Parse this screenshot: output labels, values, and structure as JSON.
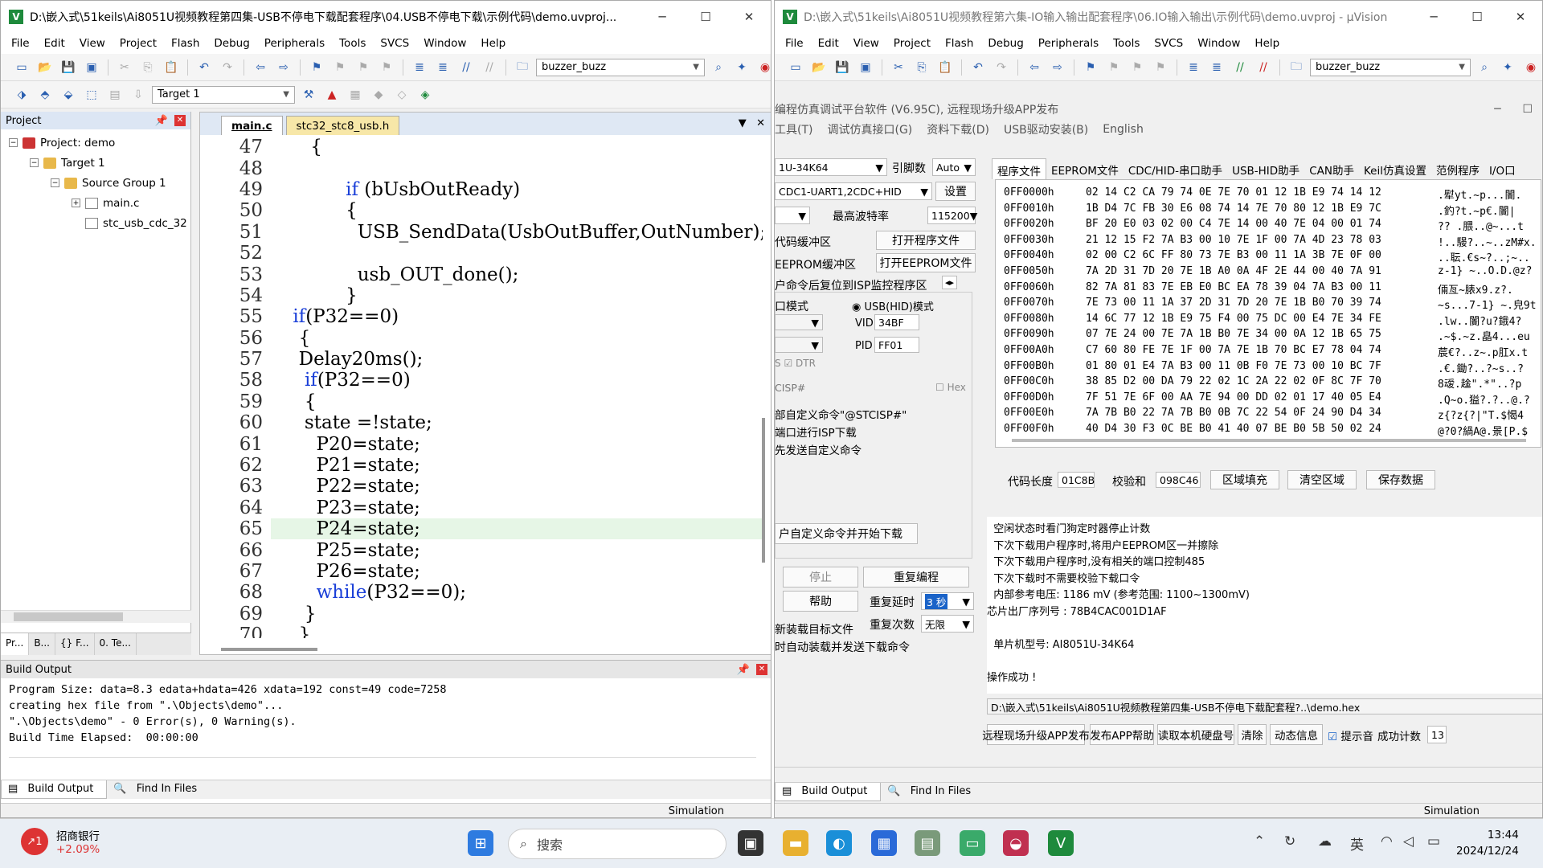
{
  "left": {
    "title": "D:\\嵌入式\\51keils\\Ai8051U视频教程第四集-USB不停电下载配套程序\\04.USB不停电下载\\示例代码\\demo.uvproj...",
    "menu": [
      "File",
      "Edit",
      "View",
      "Project",
      "Flash",
      "Debug",
      "Peripherals",
      "Tools",
      "SVCS",
      "Window",
      "Help"
    ],
    "toolbar_combo": "buzzer_buzz",
    "target_combo": "Target 1",
    "project_title": "Project",
    "tree": [
      "Project: demo",
      "Target 1",
      "Source Group 1",
      "main.c",
      "stc_usb_cdc_32"
    ],
    "ptabs": [
      "Pr...",
      "B...",
      "{} F...",
      "0. Te..."
    ],
    "tabs": [
      "main.c",
      "stc32_stc8_usb.h"
    ],
    "code": [
      {
        "n": "47",
        "t": "    {"
      },
      {
        "n": "48",
        "t": ""
      },
      {
        "n": "49",
        "k": "if",
        "t": " (bUsbOutReady)",
        "i": "          "
      },
      {
        "n": "50",
        "t": "          {"
      },
      {
        "n": "51",
        "t": "            USB_SendData(UsbOutBuffer,OutNumber);"
      },
      {
        "n": "52",
        "t": ""
      },
      {
        "n": "53",
        "t": "            usb_OUT_done();"
      },
      {
        "n": "54",
        "t": "          }"
      },
      {
        "n": "55",
        "k": "if",
        "t": "(P32==0)",
        "i": " "
      },
      {
        "n": "56",
        "t": "  {"
      },
      {
        "n": "57",
        "t": "  Delay20ms();"
      },
      {
        "n": "58",
        "k": "if",
        "t": "(P32==0)",
        "i": "   "
      },
      {
        "n": "59",
        "t": "   {"
      },
      {
        "n": "60",
        "t": "   state =!state;"
      },
      {
        "n": "61",
        "t": "     P20=state;"
      },
      {
        "n": "62",
        "t": "     P21=state;"
      },
      {
        "n": "63",
        "t": "     P22=state;"
      },
      {
        "n": "64",
        "t": "     P23=state;"
      },
      {
        "n": "65",
        "t": "     P24=state;",
        "hl": true
      },
      {
        "n": "66",
        "t": "     P25=state;"
      },
      {
        "n": "67",
        "t": "     P26=state;"
      },
      {
        "n": "68",
        "k": "while",
        "t": "(P32==0);",
        "i": "     "
      },
      {
        "n": "69",
        "t": "   }"
      },
      {
        "n": "70",
        "t": "  }"
      }
    ],
    "build_title": "Build Output",
    "build_lines": [
      "Program Size: data=8.3 edata+hdata=426 xdata=192 const=49 code=7258",
      "creating hex file from \".\\Objects\\demo\"...",
      "\".\\Objects\\demo\" - 0 Error(s), 0 Warning(s).",
      "Build Time Elapsed:  00:00:00"
    ],
    "btabs": [
      "Build Output",
      "Find In Files"
    ],
    "status": "Simulation"
  },
  "right": {
    "title": "D:\\嵌入式\\51keils\\Ai8051U视频教程第六集-IO输入输出配套程序\\06.IO输入输出\\示例代码\\demo.uvproj - µVision",
    "menu": [
      "File",
      "Edit",
      "View",
      "Project",
      "Flash",
      "Debug",
      "Peripherals",
      "Tools",
      "SVCS",
      "Window",
      "Help"
    ],
    "toolbar_combo": "buzzer_buzz",
    "tool_title": "编程仿真调试平台软件 (V6.95C), 远程现场升级APP发布",
    "tool_menu": [
      "工具(T)",
      "调试仿真接口(G)",
      "资料下载(D)",
      "USB驱动安装(B)",
      "English"
    ],
    "mcu": "1U-34K64",
    "pin_label": "引脚数",
    "pin_val": "Auto",
    "port": "CDC1-UART1,2CDC+HID",
    "settings": "设置",
    "baud_label": "最高波特率",
    "baud": "115200",
    "code_buf": "代码缓冲区",
    "open_prog": "打开程序文件",
    "eeprom_buf": "EEPROM缓冲区",
    "open_eeprom": "打开EEPROM文件",
    "after_cmd": "户命令后复位到ISP监控程序区",
    "mode_label": "口模式",
    "usb_mode": "USB(HID)模式",
    "vid_label": "VID",
    "vid": "34BF",
    "pid_label": "PID",
    "pid": "FF01",
    "s_label": "S",
    "dtr": "DTR",
    "isp_val": "CISP#",
    "hex_chk": "Hex",
    "opt1": "部自定义命令\"@STCISP#\"",
    "opt2": "端口进行ISP下载",
    "opt3": "先发送自定义命令",
    "custom_dl": "户自定义命令并开始下载",
    "stop": "停止",
    "reprog": "重复编程",
    "help": "帮助",
    "delay_label": "重复延时",
    "delay": "3 秒",
    "count_label": "重复次数",
    "count": "无限",
    "reload": "新装载目标文件",
    "autoload": "时自动装载并发送下载命令",
    "ptabs": [
      "程序文件",
      "EEPROM文件",
      "CDC/HID-串口助手",
      "USB-HID助手",
      "CAN助手",
      "Keil仿真设置",
      "范例程序",
      "I/O口"
    ],
    "hex": [
      {
        "a": "0FF0000h",
        "b": "02 14 C2 CA 79 74 0E 7E 70 01 12 1B E9 74 14 12",
        "c": ".犚yt.~p...闠."
      },
      {
        "a": "0FF0010h",
        "b": "1B D4 7C FB 30 E6 08 74 14 7E 70 80 12 1B E9 7C",
        "c": ".釣?t.~p€.闠|"
      },
      {
        "a": "0FF0020h",
        "b": "BF 20 E0 03 02 00 C4 7E 14 00 40 7E 04 00 01 74",
        "c": "?? .腲..@~...t"
      },
      {
        "a": "0FF0030h",
        "b": "21 12 15 F2 7A B3 00 10 7E 1F 00 7A 4D 23 78 03",
        "c": "!..騴?..~..zM#x."
      },
      {
        "a": "0FF0040h",
        "b": "02 00 C2 6C FF 80 73 7E B3 00 11 1A 3B 7E 0F 00",
        "c": "..耺.€s~?..;~.."
      },
      {
        "a": "0FF0050h",
        "b": "7A 2D 31 7D 20 7E 1B A0 0A 4F 2E 44 00 40 7A 91",
        "c": "z-1} ~..O.D.@z?"
      },
      {
        "a": "0FF0060h",
        "b": "82 7A 81 83 7E EB E0 BC EA 78 39 04 7A B3 00 11",
        "c": "倆亙~脿x9.z?."
      },
      {
        "a": "0FF0070h",
        "b": "7E 73 00 11 1A 37 2D 31 7D 20 7E 1B B0 70 39 74",
        "c": "~s...7-1} ~.皃9t"
      },
      {
        "a": "0FF0080h",
        "b": "14 6C 77 12 1B E9 75 F4 00 75 DC 00 E4 7E 34 FE",
        "c": ".lw..闠?u?鋨4?"
      },
      {
        "a": "0FF0090h",
        "b": "07 7E 24 00 7E 7A 1B B0 7E 34 00 0A 12 1B 65 75",
        "c": ".~$.~z.皛4...eu"
      },
      {
        "a": "0FF00A0h",
        "b": "C7 60 80 FE 7E 1F 00 7A 7E 1B 70 BC E7 78 04 74",
        "c": "莀€?..z~.p肛x.t"
      },
      {
        "a": "0FF00B0h",
        "b": "01 80 01 E4 7A B3 00 11 0B F0 7E 73 00 10 BC 7F",
        "c": ".€.鋤?..?~s..?"
      },
      {
        "a": "0FF00C0h",
        "b": "38 85 D2 00 DA 79 22 02 1C 2A 22 02 0F 8C 7F 70",
        "c": "8叆.趛\".*\"..?p"
      },
      {
        "a": "0FF00D0h",
        "b": "7F 51 7E 6F 00 AA 7E 94 00 DD 02 01 17 40 05 E4",
        "c": ".Q~o.獈?.?..@.?"
      },
      {
        "a": "0FF00E0h",
        "b": "7A 7B B0 22 7A 7B B0 0B 7C 22 54 0F 24 90 D4 34",
        "c": "z{?z{?|\"T.$愒4"
      },
      {
        "a": "0FF00F0h",
        "b": "40 D4 30 F3 0C BE B0 41 40 07 BE B0 5B 50 02 24",
        "c": "@?0?緺A@.景[P.$"
      }
    ],
    "code_len_label": "代码长度",
    "code_len": "01C8B",
    "checksum_label": "校验和",
    "checksum": "098C46",
    "fill": "区域填充",
    "clear": "清空区域",
    "save": "保存数据",
    "log": [
      "  空闲状态时看门狗定时器停止计数",
      "  下次下载用户程序时,将用户EEPROM区一并擦除",
      "  下次下载用户程序时,没有相关的端口控制485",
      "  下次下载时不需要校验下载口令",
      "  内部参考电压: 1186 mV (参考范围: 1100~1300mV)",
      "芯片出厂序列号 : 78B4CAC001D1AF",
      "",
      "  单片机型号: AI8051U-34K64",
      "",
      "操作成功 !"
    ],
    "path": "D:\\嵌入式\\51keils\\Ai8051U视频教程第四集-USB不停电下载配套程?..\\demo.hex",
    "bottom": [
      "远程现场升级APP发布",
      "发布APP帮助",
      "读取本机硬盘号",
      "清除",
      "动态信息"
    ],
    "sound": "提示音",
    "success_label": "成功计数",
    "success": "13",
    "btabs": [
      "Build Output",
      "Find In Files"
    ],
    "status": "Simulation"
  },
  "taskbar": {
    "stock_name": "招商银行",
    "stock_pct": "+2.09%",
    "search": "搜索",
    "ime": "英",
    "time": "13:44",
    "date": "2024/12/24"
  }
}
